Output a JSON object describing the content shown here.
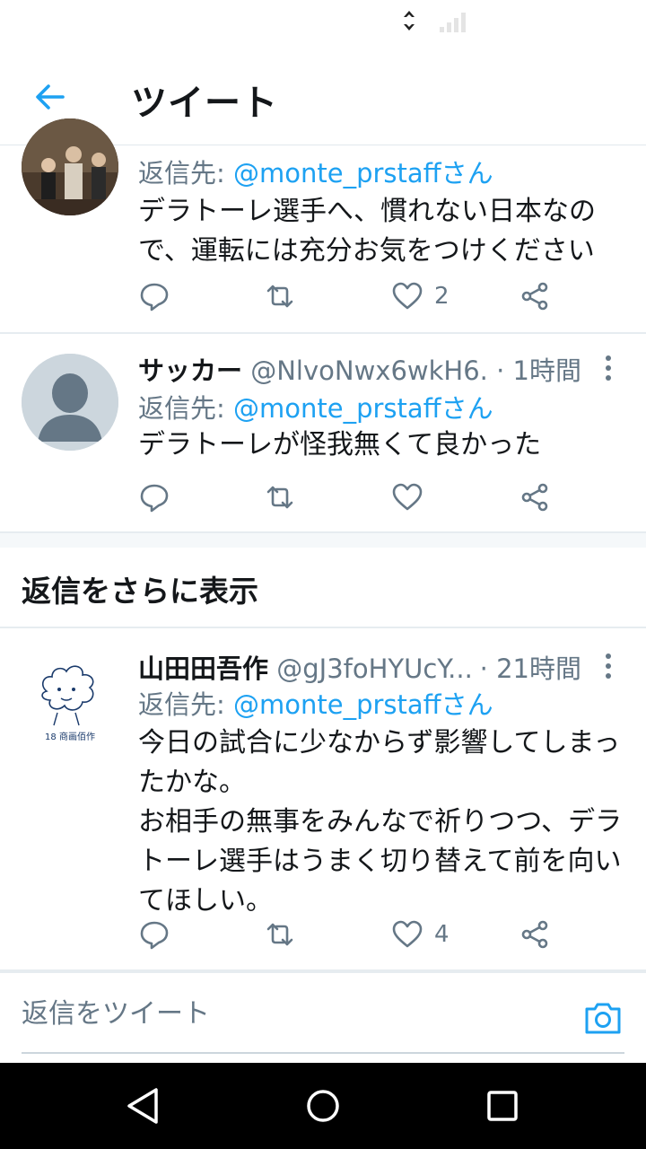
{
  "header": {
    "title": "ツイート"
  },
  "tweets": [
    {
      "reply_to_label": "返信先:",
      "reply_to_mention": "@monte_prstaffさん",
      "text": "デラトーレ選手へ、慣れない日本なので、運転には充分お気をつけください",
      "like_count": "2"
    },
    {
      "name": "サッカー",
      "handle": "@NlvoNwx6wkH6...",
      "time": "· 1時間",
      "reply_to_label": "返信先:",
      "reply_to_mention": "@monte_prstaffさん",
      "text": "デラトーレが怪我無くて良かった",
      "like_count": ""
    },
    {
      "name": "山田田吾作",
      "handle": "@gJ3foHYUcY...",
      "time": "· 21時間",
      "avatar_caption": "18 商画佰作",
      "reply_to_label": "返信先:",
      "reply_to_mention": "@monte_prstaffさん",
      "text": "今日の試合に少なからず影響してしまったかな。\nお相手の無事をみんなで祈りつつ、デラトーレ選手はうまく切り替えて前を向いてほしい。",
      "like_count": "4"
    }
  ],
  "show_more": {
    "label": "返信をさらに表示"
  },
  "composer": {
    "placeholder": "返信をツイート"
  },
  "icons": {
    "back": "arrow-left-icon",
    "reply": "reply-bubble-icon",
    "retweet": "retweet-icon",
    "like": "heart-icon",
    "share": "share-icon",
    "more": "vertical-dots-icon",
    "camera": "camera-icon"
  },
  "colors": {
    "accent": "#1da1f2",
    "secondary_text": "#657786",
    "primary_text": "#14171a"
  }
}
